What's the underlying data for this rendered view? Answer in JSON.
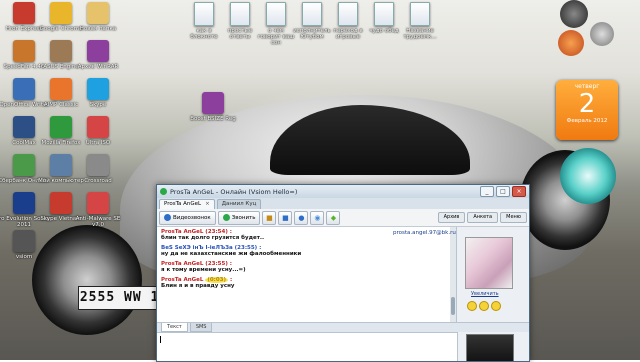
{
  "desktop": {
    "icons": [
      {
        "label": "Hron Express",
        "color": "#c73a2e"
      },
      {
        "label": "Google Chrome",
        "color": "#e8b52b"
      },
      {
        "label": "Новая папка",
        "color": "#e6c36a"
      },
      {
        "label": "SpeedFan 4.46",
        "color": "#c8762b"
      },
      {
        "label": "ASUS Engine",
        "color": "#9c7a56"
      },
      {
        "label": "Архив WinRAR",
        "color": "#8c3f9c"
      },
      {
        "label": "OpenOffice Writer",
        "color": "#3a6fb8"
      },
      {
        "label": "AIMP Classic",
        "color": "#e8752b"
      },
      {
        "label": "Skype",
        "color": "#1fa0e0"
      },
      {
        "label": "CoolMax",
        "color": "#2c4f86"
      },
      {
        "label": "Mozilla Firefox",
        "color": "#2f9a3d"
      },
      {
        "label": "Ultra ISO",
        "color": "#d64545"
      },
      {
        "label": "Сбербанк Онлайн",
        "color": "#4a9a49"
      },
      {
        "label": "Мой компьютер",
        "color": "#5d7fa6"
      },
      {
        "label": "Crossroad",
        "color": "#8a8a8a"
      },
      {
        "label": "Pro Evolution Soccer 2011",
        "color": "#1a3e8c"
      },
      {
        "label": "Skype Vietnam",
        "color": "#c73a2e"
      },
      {
        "label": "Anti-Malware SE v7.0",
        "color": "#d64545"
      },
      {
        "label": "vsiom",
        "color": "#555555"
      }
    ],
    "docs": [
      {
        "label": "как в блокноте"
      },
      {
        "label": "простые ответы"
      },
      {
        "label": "о чем говорит ваш сон"
      },
      {
        "label": "исполнитель Ютубом"
      },
      {
        "label": "переход в игровые"
      },
      {
        "label": "чудо обед"
      },
      {
        "label": "Название трудоемк..."
      }
    ],
    "archive_label": "Boost BSIZE Reg",
    "plate": "2555 WW 17",
    "calendar": {
      "weekday": "четверг",
      "day": "2",
      "month": "Февраль 2012"
    }
  },
  "qip": {
    "title": "ProsTa AnGeL - Онлайн (Vsiom Hello=)",
    "tabs": [
      {
        "label": "ProsTa AnGeL"
      },
      {
        "label": "Даниил Куц"
      }
    ],
    "toolbar": {
      "video_label": "Видеозвонок",
      "call_label": "Звонить",
      "right_buttons": [
        "Архив",
        "Анкета",
        "Меню"
      ]
    },
    "email": "prosta.angel.97@bk.ru",
    "zoom_label": "Увеличить",
    "messages": [
      {
        "header": "ProsTa AnGeL (23:54) :",
        "text": "блин так долго грузится будет..",
        "who": "me"
      },
      {
        "header": "BeS SeXЭ iнЪ I-ieЛЪЗа (23:55) :",
        "text": "ну да не казахстанские жи фалообменники",
        "who": "them"
      },
      {
        "header": "ProsTa AnGeL (23:55) :",
        "text": "я к тому времени усну...=)",
        "who": "me"
      },
      {
        "header_name": "ProsTa AnGeL",
        "header_time": "(0:03)",
        "header_end": " :",
        "text": "Блин я и в правду усну",
        "who": "me"
      }
    ],
    "input_tabs": [
      "Текст",
      "SMS"
    ]
  }
}
